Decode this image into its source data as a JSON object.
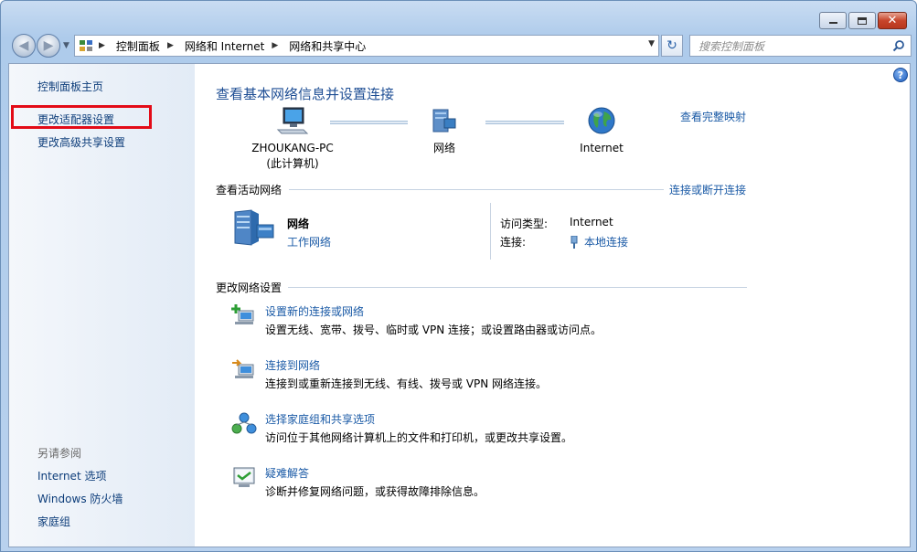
{
  "window": {
    "minimize_label": "–",
    "close_label": "✕"
  },
  "nav": {
    "back_glyph": "◀",
    "forward_glyph": "▶",
    "breadcrumb": [
      "控制面板",
      "网络和 Internet",
      "网络和共享中心"
    ],
    "search_placeholder": "搜索控制面板",
    "refresh_glyph": "↻"
  },
  "sidebar": {
    "home": "控制面板主页",
    "change_adapter": "更改适配器设置",
    "change_sharing": "更改高级共享设置",
    "see_also_heading": "另请参阅",
    "see_also": [
      "Internet 选项",
      "Windows 防火墙",
      "家庭组"
    ]
  },
  "main": {
    "title": "查看基本网络信息并设置连接",
    "view_full_map": "查看完整映射",
    "map": {
      "computer_name": "ZHOUKANG-PC",
      "computer_sub": "(此计算机)",
      "network": "网络",
      "internet": "Internet"
    },
    "active_heading": "查看活动网络",
    "connect_disconnect": "连接或断开连接",
    "active_network": {
      "name": "网络",
      "type": "工作网络",
      "access_type_label": "访问类型:",
      "access_type_value": "Internet",
      "connection_label": "连接:",
      "connection_value": "本地连接"
    },
    "settings_heading": "更改网络设置",
    "tasks": [
      {
        "link": "设置新的连接或网络",
        "desc": "设置无线、宽带、拨号、临时或 VPN 连接；或设置路由器或访问点。",
        "icon": "setup-connection-icon"
      },
      {
        "link": "连接到网络",
        "desc": "连接到或重新连接到无线、有线、拨号或 VPN 网络连接。",
        "icon": "connect-network-icon"
      },
      {
        "link": "选择家庭组和共享选项",
        "desc": "访问位于其他网络计算机上的文件和打印机，或更改共享设置。",
        "icon": "homegroup-icon"
      },
      {
        "link": "疑难解答",
        "desc": "诊断并修复网络问题，或获得故障排除信息。",
        "icon": "troubleshoot-icon"
      }
    ]
  },
  "colors": {
    "link": "#1a5aa6",
    "title": "#1e4e94",
    "highlight": "#e30b17"
  }
}
